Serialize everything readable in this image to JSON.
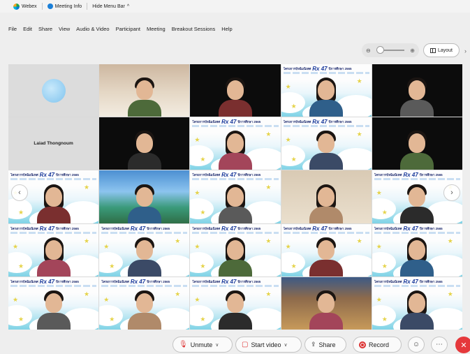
{
  "titlebar": {
    "app_name": "Webex",
    "meeting_info": "Meeting Info",
    "hide_menu": "Hide Menu Bar",
    "hide_menu_chevron": "^"
  },
  "menu": {
    "items": [
      "File",
      "Edit",
      "Share",
      "View",
      "Audio & Video",
      "Participant",
      "Meeting",
      "Breakout Sessions",
      "Help"
    ]
  },
  "view": {
    "zoom_out_icon": "zoom-out-icon",
    "zoom_in_icon": "zoom-in-icon",
    "layout_label": "Layout"
  },
  "participants": {
    "name_tile": "Laiad Thongnoum",
    "banner_thai": "โครงการปัจฉิมนิเทศ",
    "banner_rx": "Rx 47",
    "banner_year": "ปีการศึกษา 2565",
    "tiles": [
      {
        "kind": "avatar"
      },
      {
        "kind": "room"
      },
      {
        "kind": "dark"
      },
      {
        "kind": "bg"
      },
      {
        "kind": "dark"
      },
      {
        "kind": "name"
      },
      {
        "kind": "dark"
      },
      {
        "kind": "bg"
      },
      {
        "kind": "bg"
      },
      {
        "kind": "dark"
      },
      {
        "kind": "bg"
      },
      {
        "kind": "beach"
      },
      {
        "kind": "bg"
      },
      {
        "kind": "room2"
      },
      {
        "kind": "bg"
      },
      {
        "kind": "bg"
      },
      {
        "kind": "bg"
      },
      {
        "kind": "bg"
      },
      {
        "kind": "bg"
      },
      {
        "kind": "bg"
      },
      {
        "kind": "bg"
      },
      {
        "kind": "bg"
      },
      {
        "kind": "bg"
      },
      {
        "kind": "interior"
      },
      {
        "kind": "bg"
      }
    ]
  },
  "controls": {
    "unmute": "Unmute",
    "start_video": "Start video",
    "share": "Share",
    "record": "Record"
  },
  "colors": {
    "accent_red": "#e5383b",
    "webex_blue": "#0a78d7"
  }
}
